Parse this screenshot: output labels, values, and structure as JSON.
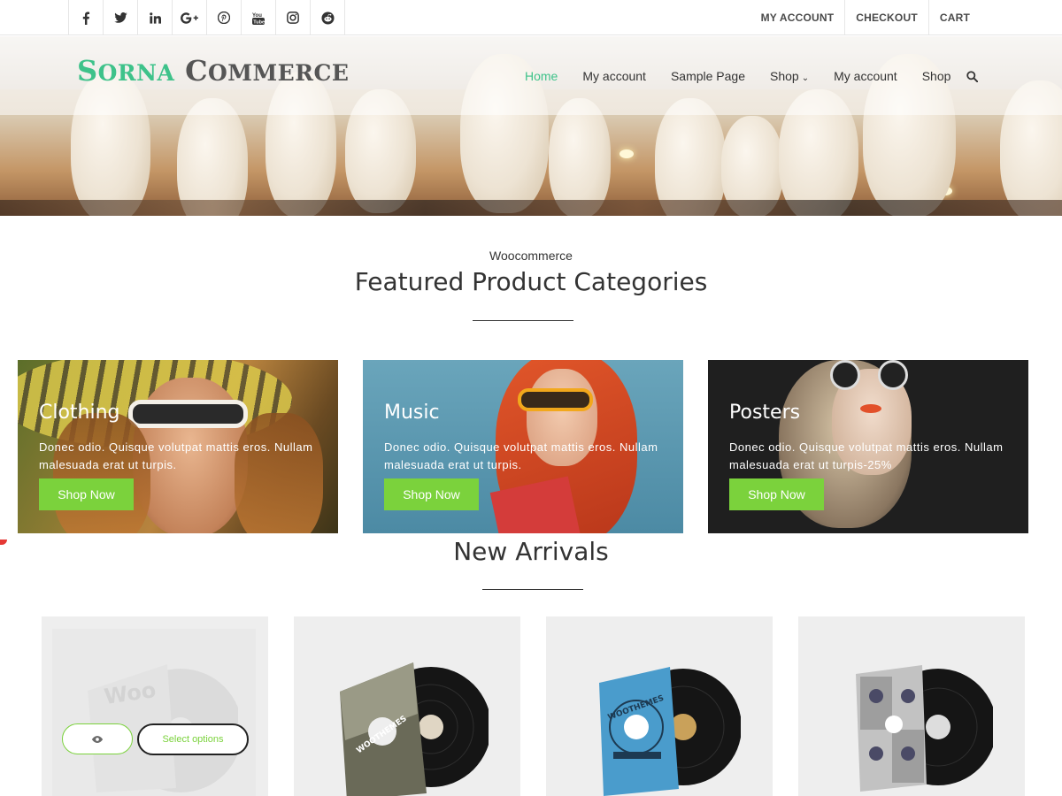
{
  "topbar": {
    "social_icons": [
      "facebook-icon",
      "twitter-icon",
      "linkedin-icon",
      "google-plus-icon",
      "pinterest-icon",
      "youtube-icon",
      "instagram-icon",
      "reddit-icon"
    ],
    "links": [
      "MY ACCOUNT",
      "CHECKOUT",
      "CART"
    ]
  },
  "header": {
    "logo": {
      "part1_cap": "S",
      "part1_rest": "ORNA",
      "part2_cap": "C",
      "part2_rest": "OMMERCE"
    },
    "nav": [
      {
        "label": "Home",
        "active": true
      },
      {
        "label": "My account"
      },
      {
        "label": "Sample Page"
      },
      {
        "label": "Shop",
        "has_dropdown": true
      },
      {
        "label": "My account"
      },
      {
        "label": "Shop"
      }
    ],
    "search_icon": "search-icon"
  },
  "featured": {
    "subtitle": "Woocommerce",
    "title": "Featured Product Categories",
    "categories": [
      {
        "title": "Clothing",
        "text": "Donec odio. Quisque volutpat mattis eros. Nullam malesuada erat ut turpis.",
        "button": "Shop Now"
      },
      {
        "title": "Music",
        "text": "Donec odio. Quisque volutpat mattis eros. Nullam malesuada erat ut turpis.",
        "button": "Shop Now"
      },
      {
        "title": "Posters",
        "text": "Donec odio. Quisque volutpat mattis eros. Nullam malesuada erat ut turpis-25%",
        "button": "Shop Now"
      }
    ]
  },
  "arrivals": {
    "title": "New Arrivals",
    "products": [
      {
        "cover_text": "Woo"
      },
      {
        "cover_text": "WOOTHEMES"
      },
      {
        "cover_text": "WOOTHEMES"
      },
      {
        "cover_text": ""
      }
    ],
    "quick_view_icon": "eye-icon",
    "select_options_label": "Select options"
  },
  "colors": {
    "accent_green": "#7bd23c",
    "logo_green": "#3ec28a",
    "text_dark": "#333333"
  }
}
